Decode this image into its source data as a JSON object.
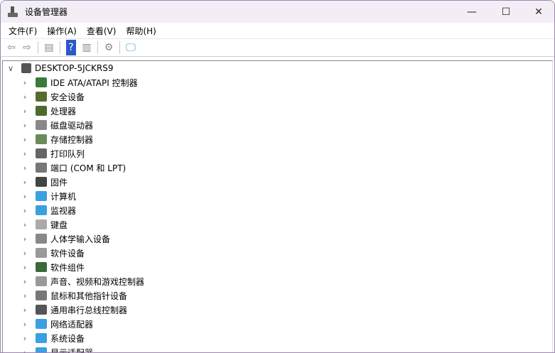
{
  "window": {
    "title": "设备管理器",
    "minimize": "—",
    "maximize": "☐",
    "close": "✕"
  },
  "menu": [
    "文件(F)",
    "操作(A)",
    "查看(V)",
    "帮助(H)"
  ],
  "toolbar": [
    {
      "name": "back-button",
      "glyph": "⇦"
    },
    {
      "name": "forward-button",
      "glyph": "⇨"
    },
    {
      "name": "sep"
    },
    {
      "name": "show-hide-console-tree-button",
      "glyph": "▤"
    },
    {
      "name": "sep"
    },
    {
      "name": "help-button",
      "glyph": "?"
    },
    {
      "name": "properties-button",
      "glyph": "▥"
    },
    {
      "name": "sep"
    },
    {
      "name": "update-driver-button",
      "glyph": "⚙"
    },
    {
      "name": "sep"
    },
    {
      "name": "scan-hardware-button",
      "glyph": "🖵"
    }
  ],
  "tree": {
    "root": "DESKTOP-5JCKRS9",
    "items": [
      {
        "label": "IDE ATA/ATAPI 控制器",
        "color": "#3a7a3a"
      },
      {
        "label": "安全设备",
        "color": "#556b2f"
      },
      {
        "label": "处理器",
        "color": "#4b6b2a"
      },
      {
        "label": "磁盘驱动器",
        "color": "#888888"
      },
      {
        "label": "存储控制器",
        "color": "#6a8a5a"
      },
      {
        "label": "打印队列",
        "color": "#666666"
      },
      {
        "label": "端口 (COM 和 LPT)",
        "color": "#777777"
      },
      {
        "label": "固件",
        "color": "#444444"
      },
      {
        "label": "计算机",
        "color": "#3aa0e0"
      },
      {
        "label": "监视器",
        "color": "#3aa0e0"
      },
      {
        "label": "键盘",
        "color": "#aaaaaa"
      },
      {
        "label": "人体学输入设备",
        "color": "#888888"
      },
      {
        "label": "软件设备",
        "color": "#999999"
      },
      {
        "label": "软件组件",
        "color": "#3a6a3a"
      },
      {
        "label": "声音、视频和游戏控制器",
        "color": "#999999"
      },
      {
        "label": "鼠标和其他指针设备",
        "color": "#777777"
      },
      {
        "label": "通用串行总线控制器",
        "color": "#555555"
      },
      {
        "label": "网络适配器",
        "color": "#3aa0e0"
      },
      {
        "label": "系统设备",
        "color": "#3aa0e0"
      },
      {
        "label": "显示适配器",
        "color": "#3aa0e0"
      }
    ]
  }
}
